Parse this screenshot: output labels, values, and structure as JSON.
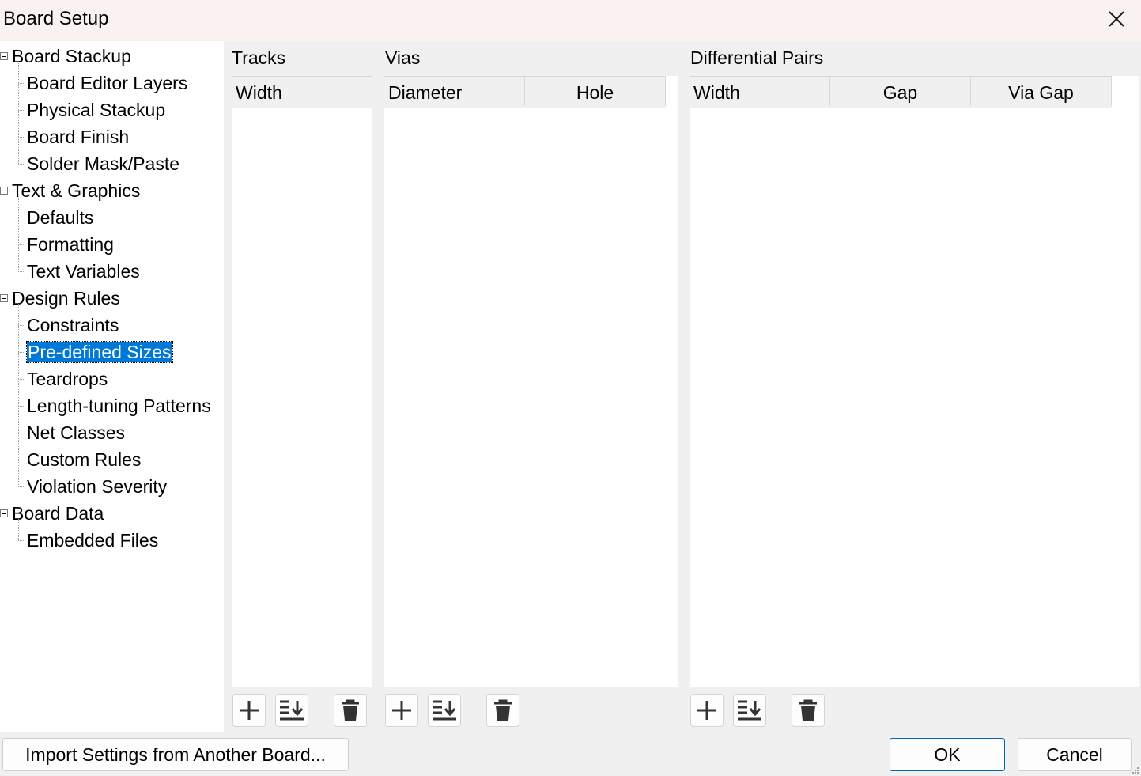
{
  "window": {
    "title": "Board Setup",
    "close_icon": "close-icon"
  },
  "tree": {
    "groups": [
      {
        "label": "Board Stackup",
        "children": [
          "Board Editor Layers",
          "Physical Stackup",
          "Board Finish",
          "Solder Mask/Paste"
        ]
      },
      {
        "label": "Text & Graphics",
        "children": [
          "Defaults",
          "Formatting",
          "Text Variables"
        ]
      },
      {
        "label": "Design Rules",
        "children": [
          "Constraints",
          "Pre-defined Sizes",
          "Teardrops",
          "Length-tuning Patterns",
          "Net Classes",
          "Custom Rules",
          "Violation Severity"
        ]
      },
      {
        "label": "Board Data",
        "children": [
          "Embedded Files"
        ]
      }
    ],
    "selected": "Pre-defined Sizes"
  },
  "tracks": {
    "title": "Tracks",
    "columns": [
      "Width"
    ],
    "rows": []
  },
  "vias": {
    "title": "Vias",
    "columns": [
      "Diameter",
      "Hole"
    ],
    "rows": []
  },
  "diff_pairs": {
    "title": "Differential Pairs",
    "columns": [
      "Width",
      "Gap",
      "Via Gap"
    ],
    "rows": []
  },
  "toolbar_icons": [
    "add-icon",
    "sort-icon",
    "delete-icon"
  ],
  "buttons": {
    "import": "Import Settings from Another Board...",
    "ok": "OK",
    "cancel": "Cancel"
  },
  "colors": {
    "selection": "#0078d7",
    "default_button_border": "#0067c0",
    "titlebar": "#f9f2f0"
  }
}
